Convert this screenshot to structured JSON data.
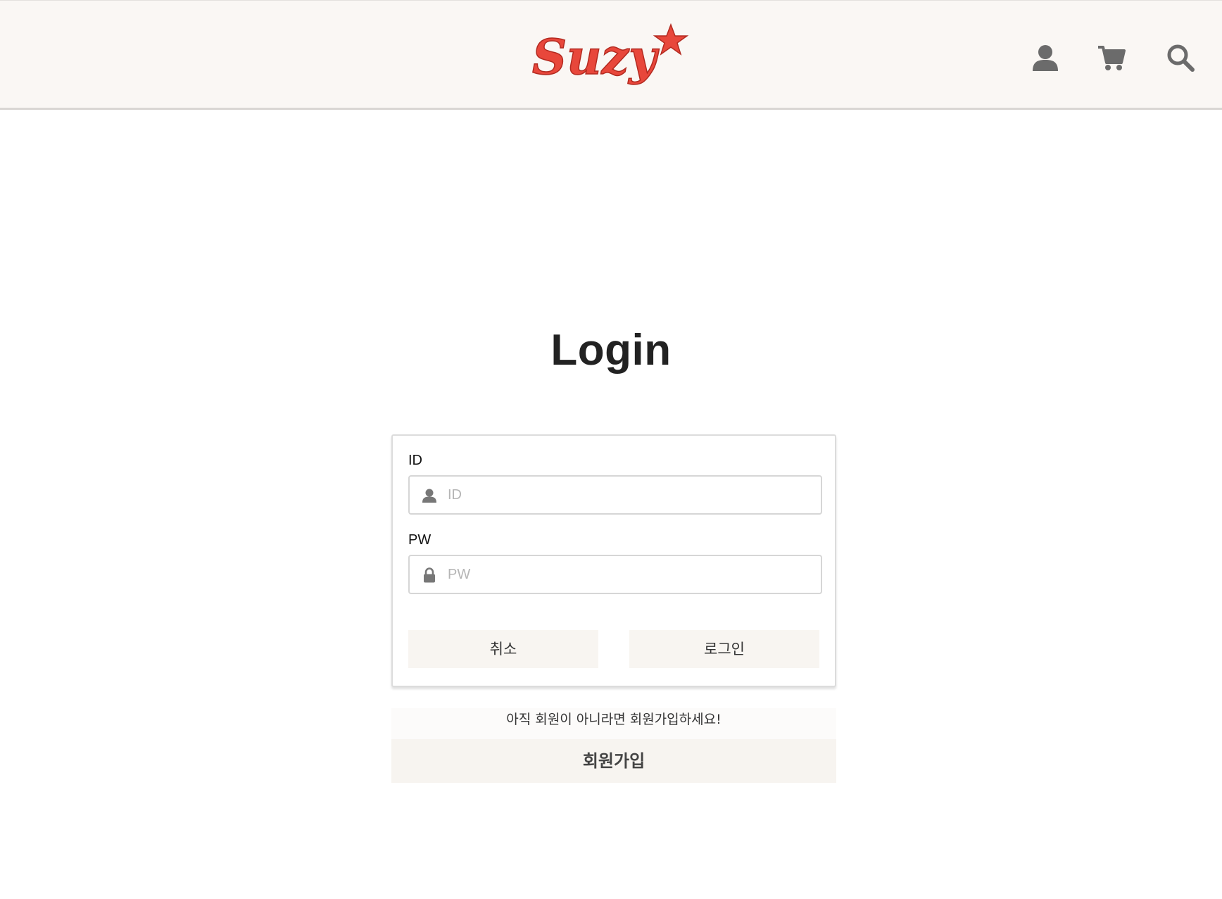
{
  "header": {
    "logo_text": "Suzy",
    "icons": [
      "user-icon",
      "cart-icon",
      "search-icon"
    ],
    "brand_color": "#e8473b",
    "icon_color": "#6b6b6b"
  },
  "page": {
    "title": "Login"
  },
  "form": {
    "id_label": "ID",
    "id_placeholder": "ID",
    "id_value": "",
    "pw_label": "PW",
    "pw_placeholder": "PW",
    "pw_value": "",
    "cancel_label": "취소",
    "login_label": "로그인"
  },
  "signup": {
    "note": "아직 회원이 아니라면 회원가입하세요!",
    "button_label": "회원가입"
  }
}
